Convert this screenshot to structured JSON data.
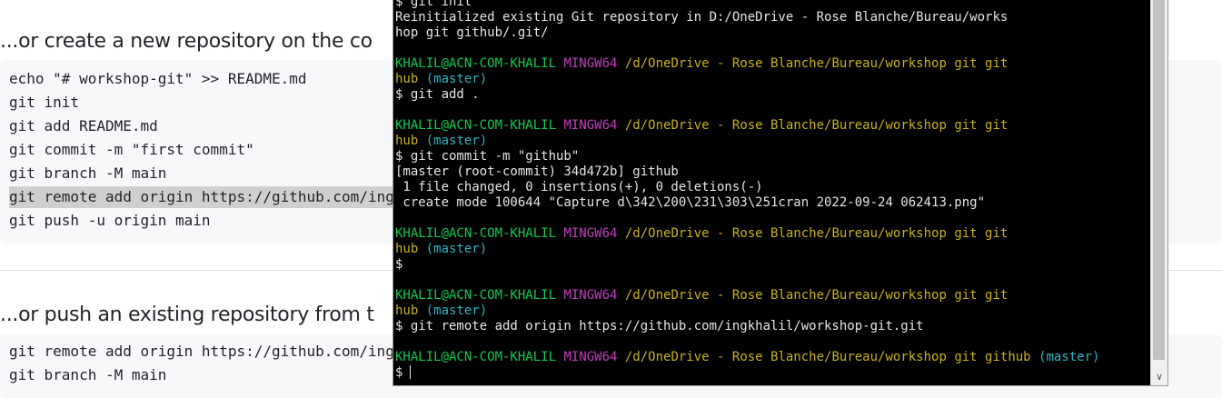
{
  "github": {
    "create_heading": "...or create a new repository on the co",
    "create_commands": [
      "echo \"# workshop-git\" >> README.md",
      "git init",
      "git add README.md",
      "git commit -m \"first commit\"",
      "git branch -M main",
      "git remote add origin https://github.com/ing",
      "git push -u origin main"
    ],
    "push_heading": "...or push an existing repository from t",
    "push_commands": [
      "git remote add origin https://github.com/ing",
      "git branch -M main"
    ]
  },
  "terminal": {
    "lines": [
      {
        "segments": [
          {
            "t": "$ git init",
            "c": "out"
          }
        ]
      },
      {
        "segments": [
          {
            "t": "Reinitialized existing Git repository in D:/OneDrive - Rose Blanche/Bureau/works",
            "c": "out"
          }
        ]
      },
      {
        "segments": [
          {
            "t": "hop git github/.git/",
            "c": "out"
          }
        ]
      },
      {
        "segments": [
          {
            "t": "",
            "c": "out"
          }
        ]
      },
      {
        "segments": [
          {
            "t": "KHALIL@ACN-COM-KHALIL",
            "c": "user"
          },
          {
            "t": " MINGW64",
            "c": "msys"
          },
          {
            "t": " /d/OneDrive - Rose Blanche/Bureau/workshop git git",
            "c": "path"
          }
        ]
      },
      {
        "segments": [
          {
            "t": "hub",
            "c": "path"
          },
          {
            "t": " (master)",
            "c": "branch"
          }
        ]
      },
      {
        "segments": [
          {
            "t": "$ git add .",
            "c": "out"
          }
        ]
      },
      {
        "segments": [
          {
            "t": "",
            "c": "out"
          }
        ]
      },
      {
        "segments": [
          {
            "t": "KHALIL@ACN-COM-KHALIL",
            "c": "user"
          },
          {
            "t": " MINGW64",
            "c": "msys"
          },
          {
            "t": " /d/OneDrive - Rose Blanche/Bureau/workshop git git",
            "c": "path"
          }
        ]
      },
      {
        "segments": [
          {
            "t": "hub",
            "c": "path"
          },
          {
            "t": " (master)",
            "c": "branch"
          }
        ]
      },
      {
        "segments": [
          {
            "t": "$ git commit -m \"github\"",
            "c": "out"
          }
        ]
      },
      {
        "segments": [
          {
            "t": "[master (root-commit) 34d472b] github",
            "c": "out"
          }
        ]
      },
      {
        "segments": [
          {
            "t": " 1 file changed, 0 insertions(+), 0 deletions(-)",
            "c": "out"
          }
        ]
      },
      {
        "segments": [
          {
            "t": " create mode 100644 \"Capture d\\342\\200\\231\\303\\251cran 2022-09-24 062413.png\"",
            "c": "out"
          }
        ]
      },
      {
        "segments": [
          {
            "t": "",
            "c": "out"
          }
        ]
      },
      {
        "segments": [
          {
            "t": "KHALIL@ACN-COM-KHALIL",
            "c": "user"
          },
          {
            "t": " MINGW64",
            "c": "msys"
          },
          {
            "t": " /d/OneDrive - Rose Blanche/Bureau/workshop git git",
            "c": "path"
          }
        ]
      },
      {
        "segments": [
          {
            "t": "hub",
            "c": "path"
          },
          {
            "t": " (master)",
            "c": "branch"
          }
        ]
      },
      {
        "segments": [
          {
            "t": "$",
            "c": "out"
          }
        ]
      },
      {
        "segments": [
          {
            "t": "",
            "c": "out"
          }
        ]
      },
      {
        "segments": [
          {
            "t": "KHALIL@ACN-COM-KHALIL",
            "c": "user"
          },
          {
            "t": " MINGW64",
            "c": "msys"
          },
          {
            "t": " /d/OneDrive - Rose Blanche/Bureau/workshop git git",
            "c": "path"
          }
        ]
      },
      {
        "segments": [
          {
            "t": "hub",
            "c": "path"
          },
          {
            "t": " (master)",
            "c": "branch"
          }
        ]
      },
      {
        "segments": [
          {
            "t": "$ git remote add origin https://github.com/ingkhalil/workshop-git.git",
            "c": "out"
          }
        ]
      },
      {
        "segments": [
          {
            "t": "",
            "c": "out"
          }
        ]
      },
      {
        "segments": [
          {
            "t": "KHALIL@ACN-COM-KHALIL",
            "c": "user"
          },
          {
            "t": " MINGW64",
            "c": "msys"
          },
          {
            "t": " /d/OneDrive - Rose Blanche/Bureau/workshop git github",
            "c": "path"
          },
          {
            "t": " (master)",
            "c": "branch"
          }
        ]
      },
      {
        "segments": [
          {
            "t": "$",
            "c": "out"
          }
        ],
        "cursor": true
      }
    ],
    "scroll_down_icon": "chevron-down-icon"
  },
  "colors": {
    "terminal_bg": "#000000",
    "user": "#13c94f",
    "msystem": "#c43bc2",
    "path": "#c9b21c",
    "branch": "#2cb4c4",
    "code_bg": "#f6f8fa"
  }
}
